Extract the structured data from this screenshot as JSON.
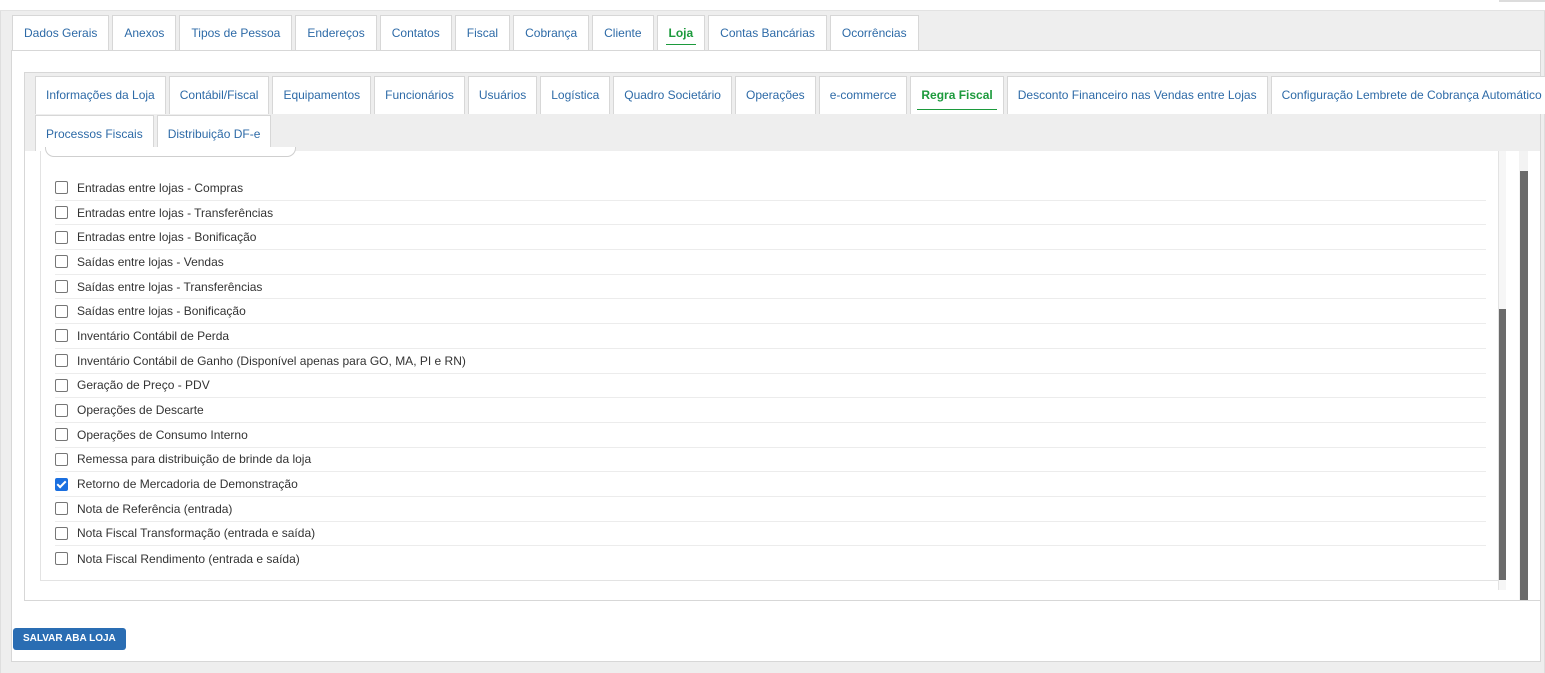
{
  "main_tabs": [
    {
      "label": "Dados Gerais",
      "active": false
    },
    {
      "label": "Anexos",
      "active": false
    },
    {
      "label": "Tipos de Pessoa",
      "active": false
    },
    {
      "label": "Endereços",
      "active": false
    },
    {
      "label": "Contatos",
      "active": false
    },
    {
      "label": "Fiscal",
      "active": false
    },
    {
      "label": "Cobrança",
      "active": false
    },
    {
      "label": "Cliente",
      "active": false
    },
    {
      "label": "Loja",
      "active": true
    },
    {
      "label": "Contas Bancárias",
      "active": false
    },
    {
      "label": "Ocorrências",
      "active": false
    }
  ],
  "sub_tabs_row1": [
    {
      "label": "Informações da Loja",
      "active": false
    },
    {
      "label": "Contábil/Fiscal",
      "active": false
    },
    {
      "label": "Equipamentos",
      "active": false
    },
    {
      "label": "Funcionários",
      "active": false
    },
    {
      "label": "Usuários",
      "active": false
    },
    {
      "label": "Logística",
      "active": false
    },
    {
      "label": "Quadro Societário",
      "active": false
    },
    {
      "label": "Operações",
      "active": false
    },
    {
      "label": "e-commerce",
      "active": false
    },
    {
      "label": "Regra Fiscal",
      "active": true
    },
    {
      "label": "Desconto Financeiro nas Vendas entre Lojas",
      "active": false
    },
    {
      "label": "Configuração Lembrete de Cobrança Automático",
      "active": false
    }
  ],
  "sub_tabs_row2": [
    {
      "label": "Processos Fiscais",
      "active": false
    },
    {
      "label": "Distribuição DF-e",
      "active": false
    }
  ],
  "options": [
    {
      "label": "Entradas entre lojas - Compras",
      "checked": false
    },
    {
      "label": "Entradas entre lojas - Transferências",
      "checked": false
    },
    {
      "label": "Entradas entre lojas - Bonificação",
      "checked": false
    },
    {
      "label": "Saídas entre lojas - Vendas",
      "checked": false
    },
    {
      "label": "Saídas entre lojas - Transferências",
      "checked": false
    },
    {
      "label": "Saídas entre lojas - Bonificação",
      "checked": false
    },
    {
      "label": "Inventário Contábil de Perda",
      "checked": false
    },
    {
      "label": "Inventário Contábil de Ganho (Disponível apenas para GO, MA, PI e RN)",
      "checked": false
    },
    {
      "label": "Geração de Preço - PDV",
      "checked": false
    },
    {
      "label": "Operações de Descarte",
      "checked": false
    },
    {
      "label": "Operações de Consumo Interno",
      "checked": false
    },
    {
      "label": "Remessa para distribuição de brinde da loja",
      "checked": false
    },
    {
      "label": "Retorno de Mercadoria de Demonstração",
      "checked": true
    },
    {
      "label": "Nota de Referência (entrada)",
      "checked": false
    },
    {
      "label": "Nota Fiscal Transformação (entrada e saída)",
      "checked": false
    },
    {
      "label": "Nota Fiscal Rendimento (entrada e saída)",
      "checked": false
    }
  ],
  "save_button": {
    "label": "SALVAR ABA LOJA"
  },
  "colors": {
    "link": "#2d6aa7",
    "active_tab": "#1c9a3c",
    "primary_button": "#2a6db3",
    "checkbox_checked": "#1a6fe0"
  }
}
